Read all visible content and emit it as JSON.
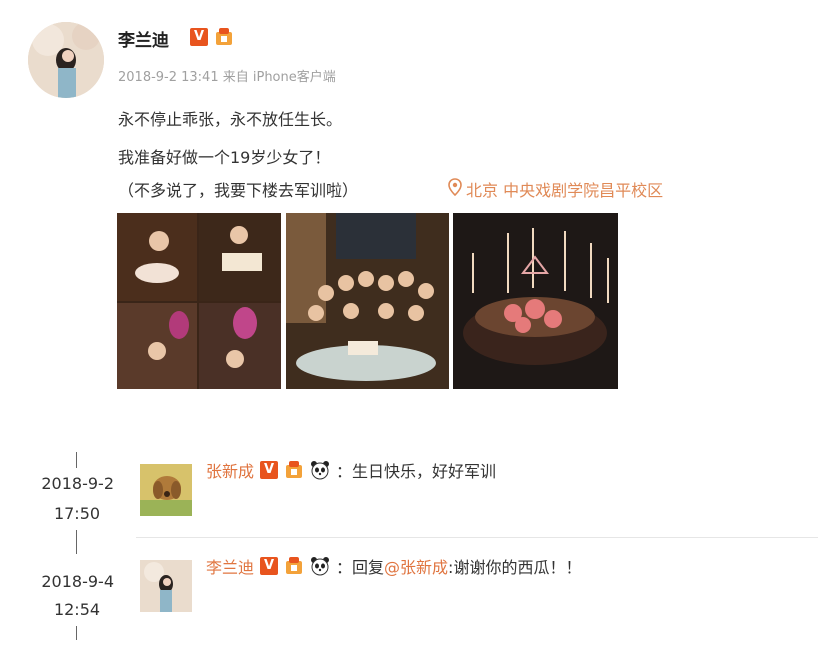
{
  "post": {
    "author": "李兰迪",
    "verified_badge": "V",
    "meta": "2018-9-2 13:41 来自 iPhone客户端",
    "lines": [
      "永不停止乖张，永不放任生长。",
      "我准备好做一个19岁少女了！",
      "（不多说了，我要下楼去军训啦）"
    ],
    "location": "北京 中央戏剧学院昌平校区",
    "accent_color": "#e07540"
  },
  "comments": [
    {
      "date": "2018-9-2",
      "time": "17:50",
      "author": "张新成",
      "verified_badge": "V",
      "text": "：生日快乐，好好军训"
    },
    {
      "date": "2018-9-4",
      "time": "12:54",
      "author": "李兰迪",
      "verified_badge": "V",
      "text_prefix": "：回复",
      "mention": "@张新成",
      "text_suffix": ":谢谢你的西瓜！！"
    }
  ],
  "icons": [
    "location-pin-icon",
    "level-icon",
    "panda-icon",
    "verified-icon"
  ]
}
